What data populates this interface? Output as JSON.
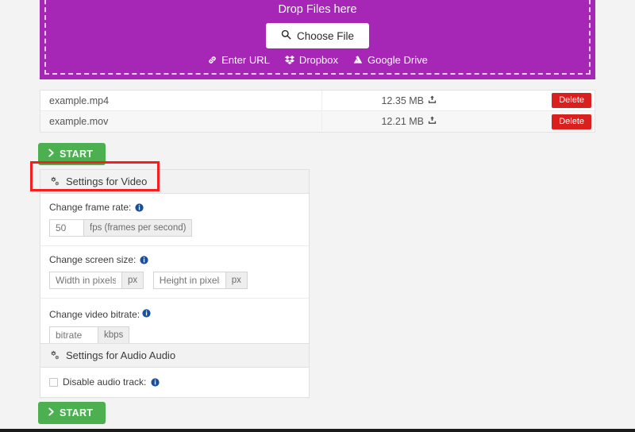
{
  "dropzone": {
    "title": "Drop Files here",
    "choose_file_label": "Choose File",
    "choose_file_icon": "search-icon",
    "background_color": "#a626b6",
    "links": [
      {
        "label": "Enter URL",
        "icon": "link-icon"
      },
      {
        "label": "Dropbox",
        "icon": "dropbox-icon"
      },
      {
        "label": "Google Drive",
        "icon": "google-drive-icon"
      }
    ]
  },
  "file_table": {
    "rows": [
      {
        "name": "example.mp4",
        "size": "12.35 MB",
        "size_icon": "upload-icon",
        "delete_label": "Delete"
      },
      {
        "name": "example.mov",
        "size": "12.21 MB",
        "size_icon": "upload-icon",
        "delete_label": "Delete"
      }
    ]
  },
  "buttons": {
    "start_top_label": "START",
    "start_bottom_label": "START",
    "start_icon": "chevron-right-icon",
    "start_color": "#4cb050",
    "delete_color": "#d9201f"
  },
  "video_settings": {
    "header": "Settings for Video",
    "header_icon": "gears-icon",
    "frame_rate": {
      "label": "Change frame rate:",
      "info_icon": "info-icon",
      "input_placeholder": "50",
      "input_value": "",
      "addon": "fps (frames per second)"
    },
    "screen_size": {
      "label": "Change screen size:",
      "info_icon": "info-icon",
      "width_placeholder": "Width in pixels",
      "width_value": "",
      "width_addon": "px",
      "height_placeholder": "Height in pixels",
      "height_value": "",
      "height_addon": "px"
    },
    "bitrate": {
      "label": "Change video bitrate:",
      "info_icon": "info-icon",
      "input_placeholder": "bitrate",
      "input_value": "",
      "addon": "kbps"
    }
  },
  "audio_settings": {
    "header": "Settings for Audio Audio",
    "header_icon": "gears-icon",
    "disable_track": {
      "label": "Disable audio track:",
      "info_icon": "info-icon",
      "checked": false
    }
  },
  "annotation": {
    "highlight_color": "#f51f1f",
    "target": "Settings for Video"
  }
}
